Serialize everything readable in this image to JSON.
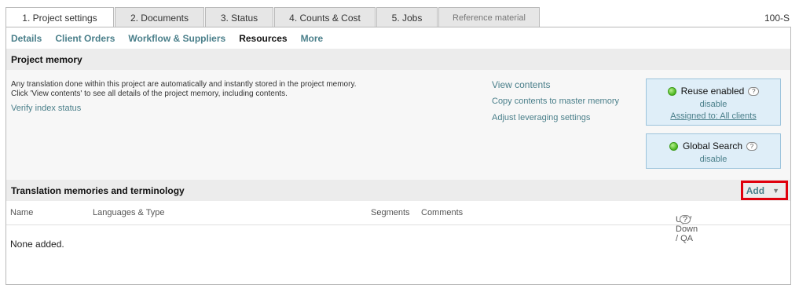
{
  "tabs": [
    {
      "label": "1. Project settings",
      "state": "active"
    },
    {
      "label": "2. Documents",
      "state": "normal"
    },
    {
      "label": "3. Status",
      "state": "normal"
    },
    {
      "label": "4. Counts & Cost",
      "state": "normal"
    },
    {
      "label": "5. Jobs",
      "state": "normal"
    },
    {
      "label": "Reference material",
      "state": "disabled"
    }
  ],
  "project_code": "100-S",
  "subnav": [
    "Details",
    "Client Orders",
    "Workflow & Suppliers",
    "Resources",
    "More"
  ],
  "subnav_current": "Resources",
  "project_memory": {
    "title": "Project memory",
    "description_line1": "Any translation done within this project are automatically and instantly stored in the project memory.",
    "description_line2": "Click 'View contents' to see all details of the project memory, including contents.",
    "verify_link": "Verify index status",
    "actions": [
      "View contents",
      "Copy contents to master memory",
      "Adjust leveraging settings"
    ],
    "reuse_box": {
      "title": "Reuse enabled",
      "disable_label": "disable",
      "assigned_label": "Assigned to: All clients",
      "status_color": "#4bb51f"
    },
    "global_box": {
      "title": "Global Search",
      "disable_label": "disable",
      "status_color": "#4bb51f"
    },
    "help_glyph": "?"
  },
  "tm": {
    "title": "Translation memories and terminology",
    "add_label": "Add",
    "add_caret": "▼",
    "columns": [
      "Name",
      "Languages & Type",
      "Segments",
      "Comments",
      "Up / Down / QA"
    ],
    "empty_text": "None added."
  },
  "colors": {
    "link": "#4a7f8a",
    "highlight": "#e0000d",
    "box_bg": "#dfeef8"
  }
}
